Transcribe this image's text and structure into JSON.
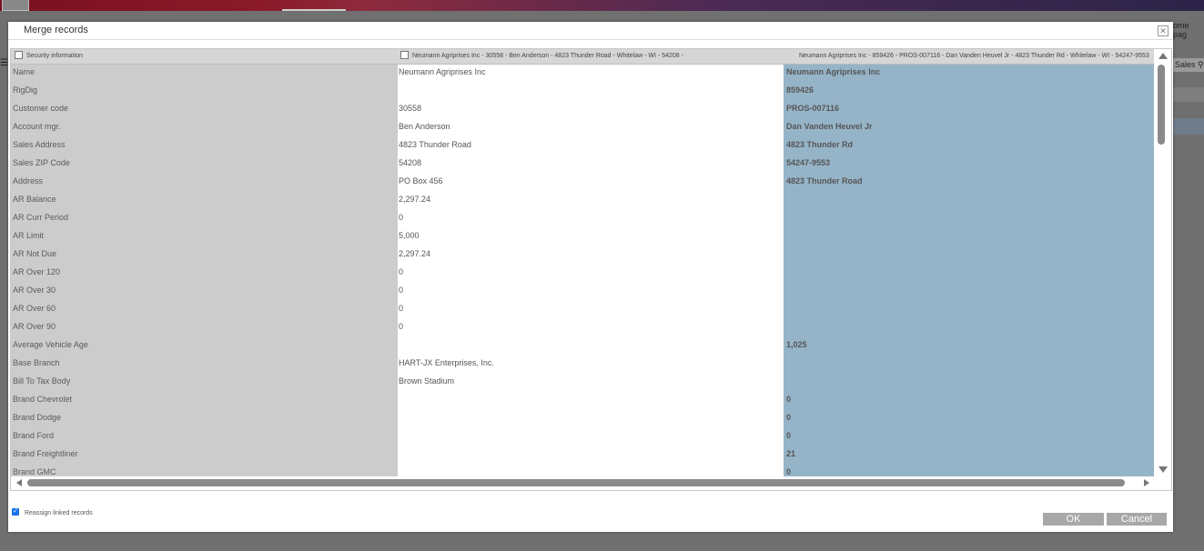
{
  "background": {
    "home_label": "ome pag",
    "sales_label": "Sales"
  },
  "dialog": {
    "title": "Merge records",
    "close_glyph": "✕",
    "columns": {
      "label_header": "Security information",
      "record1_header": "Neumann Agriprises Inc - 30558 - Ben Anderson - 4823 Thunder Road - Whitelaw - WI - 54208 -",
      "record2_header": "Neumann Agriprises Inc - 859426 - PROS-007116 - Dan Vanden Heuvel Jr - 4823 Thunder Rd - Whitelaw - WI - 54247-9553 -"
    },
    "rows": [
      {
        "label": "Name",
        "v1": "Neumann Agriprises Inc",
        "v2": "Neumann Agriprises Inc"
      },
      {
        "label": "RigDig",
        "v1": "",
        "v2": "859426"
      },
      {
        "label": "Customer code",
        "v1": "30558",
        "v2": "PROS-007116"
      },
      {
        "label": "Account mgr.",
        "v1": "Ben Anderson",
        "v2": "Dan Vanden Heuvel Jr"
      },
      {
        "label": "Sales Address",
        "v1": "4823 Thunder Road",
        "v2": "4823 Thunder Rd"
      },
      {
        "label": "Sales ZIP Code",
        "v1": "54208",
        "v2": "54247-9553"
      },
      {
        "label": "Address",
        "v1": "PO Box 456",
        "v2": "4823 Thunder Road"
      },
      {
        "label": "AR Balance",
        "v1": "2,297.24",
        "v2": ""
      },
      {
        "label": "AR Curr Period",
        "v1": "0",
        "v2": ""
      },
      {
        "label": "AR Limit",
        "v1": "5,000",
        "v2": ""
      },
      {
        "label": "AR Not Due",
        "v1": "2,297.24",
        "v2": ""
      },
      {
        "label": "AR Over 120",
        "v1": "0",
        "v2": ""
      },
      {
        "label": "AR Over 30",
        "v1": "0",
        "v2": ""
      },
      {
        "label": "AR Over 60",
        "v1": "0",
        "v2": ""
      },
      {
        "label": "AR Over 90",
        "v1": "0",
        "v2": ""
      },
      {
        "label": "Average Vehicle Age",
        "v1": "",
        "v2": "1,025"
      },
      {
        "label": "Base Branch",
        "v1": "HART-JX Enterprises, Inc.",
        "v2": ""
      },
      {
        "label": "Bill To Tax Body",
        "v1": "Brown Stadium",
        "v2": ""
      },
      {
        "label": "Brand Chevrolet",
        "v1": "",
        "v2": "0"
      },
      {
        "label": "Brand Dodge",
        "v1": "",
        "v2": "0"
      },
      {
        "label": "Brand Ford",
        "v1": "",
        "v2": "0"
      },
      {
        "label": "Brand Freightliner",
        "v1": "",
        "v2": "21"
      },
      {
        "label": "Brand GMC",
        "v1": "",
        "v2": "0"
      }
    ],
    "reassign_label": "Reassign linked records",
    "ok_label": "OK",
    "cancel_label": "Cancel"
  }
}
